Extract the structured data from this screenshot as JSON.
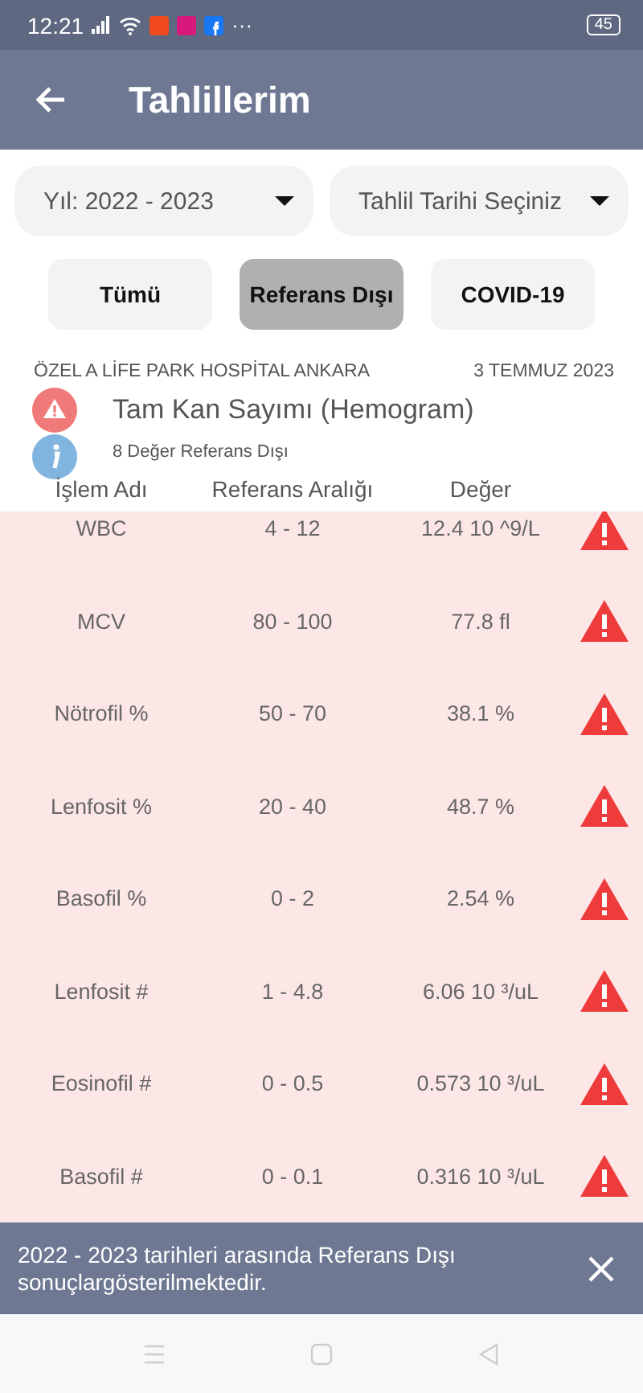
{
  "status_bar": {
    "time": "12:21",
    "more": "···",
    "battery": "45"
  },
  "header": {
    "title": "Tahlillerim"
  },
  "filters": [
    {
      "value": "Yıl: 2022 - 2023"
    },
    {
      "value": "Tahlil Tarihi Seçiniz"
    }
  ],
  "tabs": [
    {
      "label": "Tümü",
      "selected": false
    },
    {
      "label": "Referans Dışı",
      "selected": true
    },
    {
      "label": "COVID-19",
      "selected": false
    }
  ],
  "result": {
    "hospital": "ÖZEL A LİFE PARK HOSPİTAL ANKARA",
    "date": "3 TEMMUZ 2023",
    "test_name": "Tam Kan Sayımı (Hemogram)",
    "summary": "8 Değer Referans Dışı"
  },
  "table": {
    "columns": [
      "İşlem Adı",
      "Referans Aralığı",
      "Değer"
    ],
    "rows": [
      {
        "name": "WBC",
        "range": "4 - 12",
        "value": "12.4 10 ^9/L",
        "out_of_range": true
      },
      {
        "name": "MCV",
        "range": "80 - 100",
        "value": "77.8 fl",
        "out_of_range": true
      },
      {
        "name": "Nötrofil %",
        "range": "50 - 70",
        "value": "38.1 %",
        "out_of_range": true
      },
      {
        "name": "Lenfosit %",
        "range": "20 - 40",
        "value": "48.7 %",
        "out_of_range": true
      },
      {
        "name": "Basofil %",
        "range": "0 - 2",
        "value": "2.54 %",
        "out_of_range": true
      },
      {
        "name": "Lenfosit #",
        "range": "1 - 4.8",
        "value": "6.06 10 ³/uL",
        "out_of_range": true
      },
      {
        "name": "Eosinofil #",
        "range": "0 - 0.5",
        "value": "0.573 10 ³/uL",
        "out_of_range": true
      },
      {
        "name": "Basofil #",
        "range": "0 - 0.1",
        "value": "0.316 10 ³/uL",
        "out_of_range": true
      }
    ]
  },
  "snackbar": {
    "message": "2022 - 2023 tarihleri arasında Referans Dışı sonuçlargösterilmektedir."
  }
}
